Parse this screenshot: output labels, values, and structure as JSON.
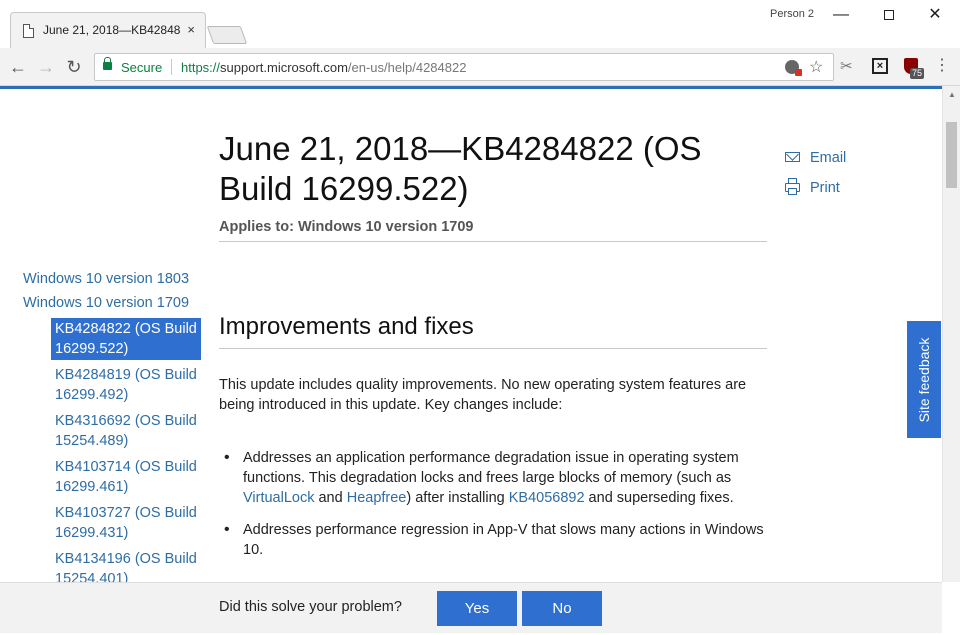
{
  "browser": {
    "tab_title": "June 21, 2018—KB42848",
    "tab_close": "×",
    "profile": "Person 2",
    "window_min": "—",
    "window_close": "✕",
    "secure_label": "Secure",
    "url_scheme": "https://",
    "url_host": "support.microsoft.com",
    "url_path": "/en-us/help/4284822",
    "extension_badge": "75",
    "icons": {
      "back": "arrow-left",
      "forward": "arrow-right",
      "reload": "reload",
      "lock": "lock",
      "star": "star",
      "menu": "menu-dots"
    }
  },
  "nav": {
    "versions": [
      "Windows 10 version 1803",
      "Windows 10 version 1709"
    ],
    "items": [
      {
        "label": "KB4284822 (OS Build 16299.522)",
        "active": true
      },
      {
        "label": "KB4284819 (OS Build 16299.492)",
        "active": false
      },
      {
        "label": "KB4316692 (OS Build 15254.489)",
        "active": false
      },
      {
        "label": "KB4103714 (OS Build 16299.461)",
        "active": false
      },
      {
        "label": "KB4103727 (OS Build 16299.431)",
        "active": false
      },
      {
        "label": "KB4134196 (OS Build 15254.401)",
        "active": false
      }
    ]
  },
  "article": {
    "title": "June 21, 2018—KB4284822 (OS Build 16299.522)",
    "applies_to": "Applies to: Windows 10 version 1709",
    "section_heading": "Improvements and fixes",
    "intro": "This update includes quality improvements. No new operating system features are being introduced in this update. Key changes include:",
    "bullet1_a": "Addresses an application performance degradation issue in operating system functions. This degradation locks and frees large blocks of memory (such as ",
    "bullet1_link1": "VirtualLock",
    "bullet1_b": " and ",
    "bullet1_link2": "Heapfree",
    "bullet1_c": ") after installing ",
    "bullet1_link3": "KB4056892",
    "bullet1_d": " and superseding fixes.",
    "bullet2": "Addresses performance regression in App-V that slows many actions in Windows 10."
  },
  "actions": {
    "email": "Email",
    "print": "Print"
  },
  "site_feedback": "Site feedback",
  "feedback_bar": {
    "question": "Did this solve your problem?",
    "yes": "Yes",
    "no": "No"
  },
  "colors": {
    "link": "#2e6da4",
    "accent": "#2e6fd0",
    "secure": "#0b8043"
  }
}
